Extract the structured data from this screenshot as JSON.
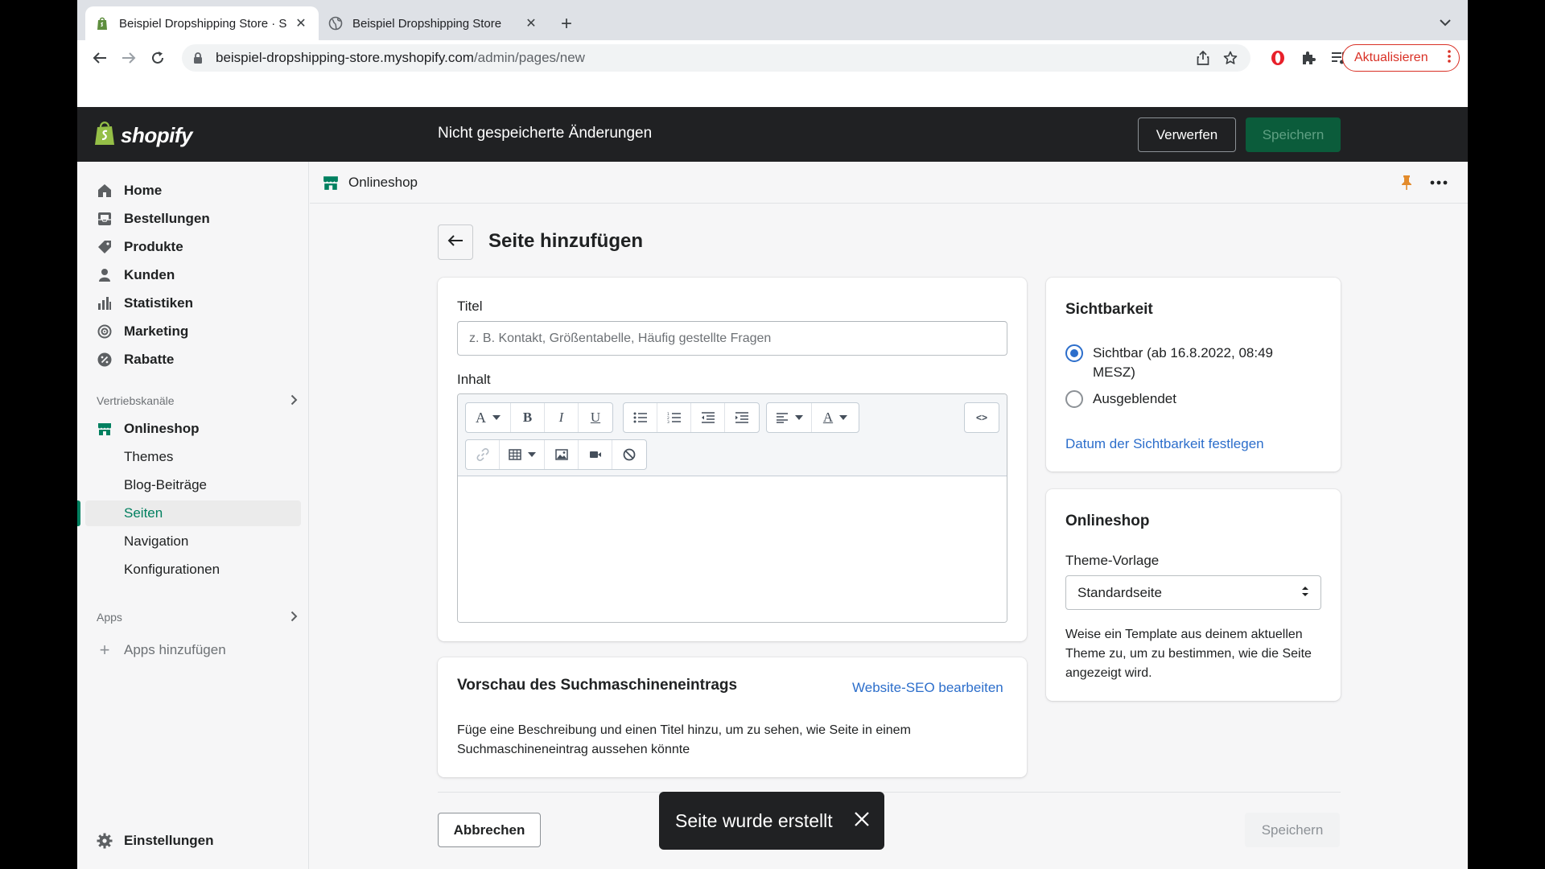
{
  "browser": {
    "tabs": [
      {
        "title": "Beispiel Dropshipping Store · S",
        "active": true
      },
      {
        "title": "Beispiel Dropshipping Store",
        "active": false
      }
    ],
    "url_host": "beispiel-dropshipping-store.myshopify.com",
    "url_path": "/admin/pages/new",
    "update_label": "Aktualisieren"
  },
  "topbar": {
    "logo": "shopify",
    "status": "Nicht gespeicherte Änderungen",
    "discard_label": "Verwerfen",
    "save_label": "Speichern"
  },
  "sidebar": {
    "items": [
      {
        "label": "Home",
        "icon": "home-icon"
      },
      {
        "label": "Bestellungen",
        "icon": "orders-icon"
      },
      {
        "label": "Produkte",
        "icon": "tag-icon"
      },
      {
        "label": "Kunden",
        "icon": "person-icon"
      },
      {
        "label": "Statistiken",
        "icon": "bar-chart-icon"
      },
      {
        "label": "Marketing",
        "icon": "target-icon"
      },
      {
        "label": "Rabatte",
        "icon": "discount-icon"
      }
    ],
    "sales_channels_heading": "Vertriebskanäle",
    "channel": "Onlineshop",
    "sub_items": [
      "Themes",
      "Blog-Beiträge",
      "Seiten",
      "Navigation",
      "Konfigurationen"
    ],
    "selected_sub_item": "Seiten",
    "apps_heading": "Apps",
    "apps_add": "Apps hinzufügen",
    "settings": "Einstellungen"
  },
  "channel_bar": {
    "label": "Onlineshop"
  },
  "page": {
    "title": "Seite hinzufügen",
    "title_label": "Titel",
    "title_placeholder": "z. B. Kontakt, Größentabelle, Häufig gestellte Fragen",
    "content_label": "Inhalt",
    "seo": {
      "heading": "Vorschau des Suchmaschineneintrags",
      "edit_link": "Website-SEO bearbeiten",
      "description": "Füge eine Beschreibung und einen Titel hinzu, um zu sehen, wie Seite in einem Suchmaschineneintrag aussehen könnte"
    },
    "visibility": {
      "heading": "Sichtbarkeit",
      "option_visible": "Sichtbar (ab 16.8.2022, 08:49 MESZ)",
      "option_hidden": "Ausgeblendet",
      "selected": "visible",
      "date_link": "Datum der Sichtbarkeit festlegen"
    },
    "online_store": {
      "heading": "Onlineshop",
      "template_label": "Theme-Vorlage",
      "template_value": "Standardseite",
      "help_text": "Weise ein Template aus deinem aktuellen Theme zu, um zu bestimmen, wie die Seite angezeigt wird."
    },
    "cancel_label": "Abbrechen",
    "save_label": "Speichern"
  },
  "toast": {
    "message": "Seite wurde erstellt"
  },
  "colors": {
    "accent_green": "#008060",
    "link_blue": "#2c6ecb",
    "topbar_bg": "#202123",
    "browser_update_red": "#d93025"
  }
}
